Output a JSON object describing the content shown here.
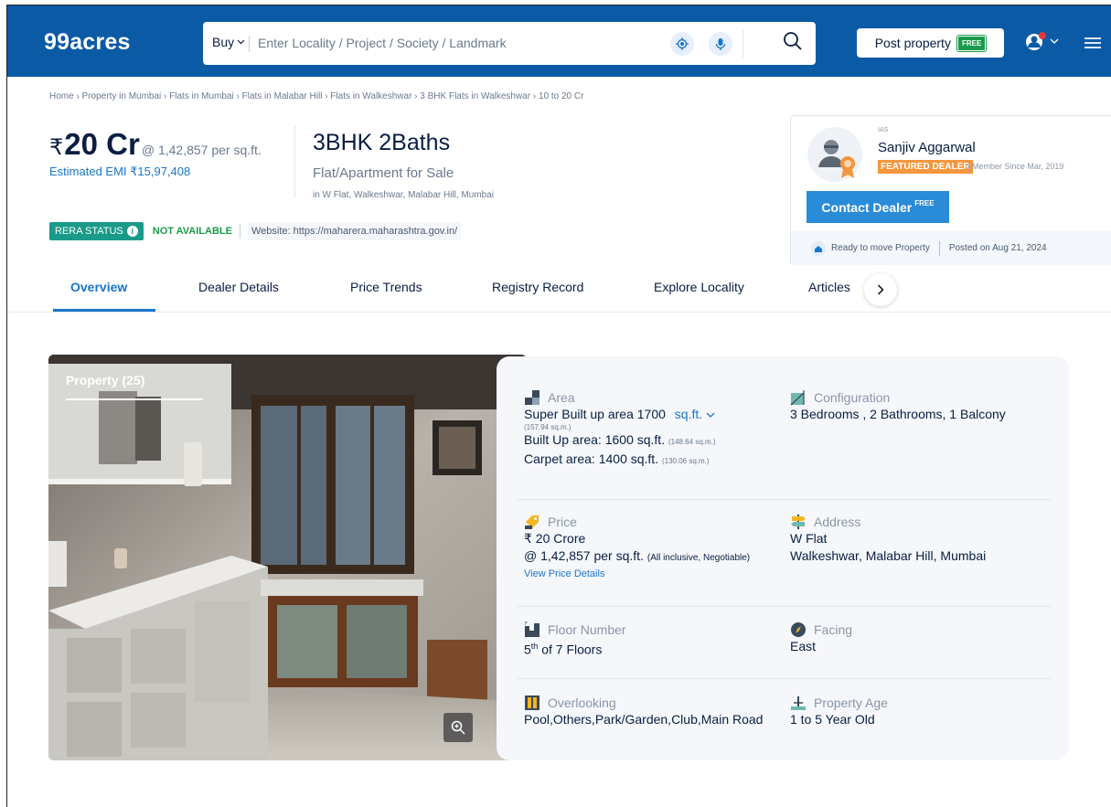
{
  "header": {
    "logo": "99acres",
    "buy_label": "Buy",
    "search_placeholder": "Enter Locality / Project / Society / Landmark",
    "post_label": "Post property",
    "post_badge": "FREE"
  },
  "breadcrumb": "Home › Property in Mumbai › Flats in Mumbai › Flats in Malabar Hill › Flats in Walkeshwar › 3 BHK Flats in Walkeshwar › 10 to 20 Cr",
  "listing": {
    "currency": "₹",
    "price": "20 Cr",
    "price_per_sqft": "@ 1,42,857 per sq.ft.",
    "emi": "Estimated EMI ₹15,97,408",
    "title": "3BHK 2Baths",
    "type": "Flat/Apartment for Sale",
    "location": "in W Flat, Walkeshwar, Malabar Hill, Mumbai",
    "rera_label": "RERA STATUS",
    "rera_value": "NOT AVAILABLE",
    "website": "Website: https://maharera.maharashtra.gov.in/"
  },
  "dealer": {
    "tag": "IAS",
    "name": "Sanjiv Aggarwal",
    "featured": "FEATURED DEALER",
    "since": "| Member Since Mar, 2019",
    "contact_label": "Contact Dealer",
    "contact_badge": "FREE",
    "status": "Ready to move Property",
    "posted": "Posted on Aug 21, 2024"
  },
  "tabs": [
    {
      "label": "Overview"
    },
    {
      "label": "Dealer Details"
    },
    {
      "label": "Price Trends"
    },
    {
      "label": "Registry Record"
    },
    {
      "label": "Explore Locality"
    },
    {
      "label": "Articles"
    }
  ],
  "gallery": {
    "title": "Property (25)"
  },
  "details": {
    "area": {
      "label": "Area",
      "super": "Super Built up area 1700",
      "unit": "sq.ft.",
      "super_sqm": "(157.94 sq.m.)",
      "built": "Built Up area: 1600 sq.ft.",
      "built_sqm": "(148.64 sq.m.)",
      "carpet": "Carpet area: 1400 sq.ft.",
      "carpet_sqm": "(130.06 sq.m.)"
    },
    "configuration": {
      "label": "Configuration",
      "value": "3 Bedrooms , 2 Bathrooms, 1 Balcony"
    },
    "price": {
      "label": "Price",
      "value": "₹ 20 Crore",
      "psf": "@ 1,42,857 per sq.ft.",
      "psf_note": "(All inclusive, Negotiable)",
      "link": "View Price Details"
    },
    "address": {
      "label": "Address",
      "line1": "W Flat",
      "line2": "Walkeshwar, Malabar Hill, Mumbai"
    },
    "floor": {
      "label": "Floor Number",
      "num": "5",
      "sup": "th",
      "rest": "of 7 Floors"
    },
    "facing": {
      "label": "Facing",
      "value": "East"
    },
    "overlooking": {
      "label": "Overlooking",
      "value": "Pool,Others,Park/Garden,Club,Main Road"
    },
    "age": {
      "label": "Property Age",
      "value": "1 to 5 Year Old"
    }
  },
  "colors": {
    "brand": "#0B5AA6",
    "link": "#1976c9",
    "featured": "#F4963D",
    "rera": "#1a9a8a"
  }
}
